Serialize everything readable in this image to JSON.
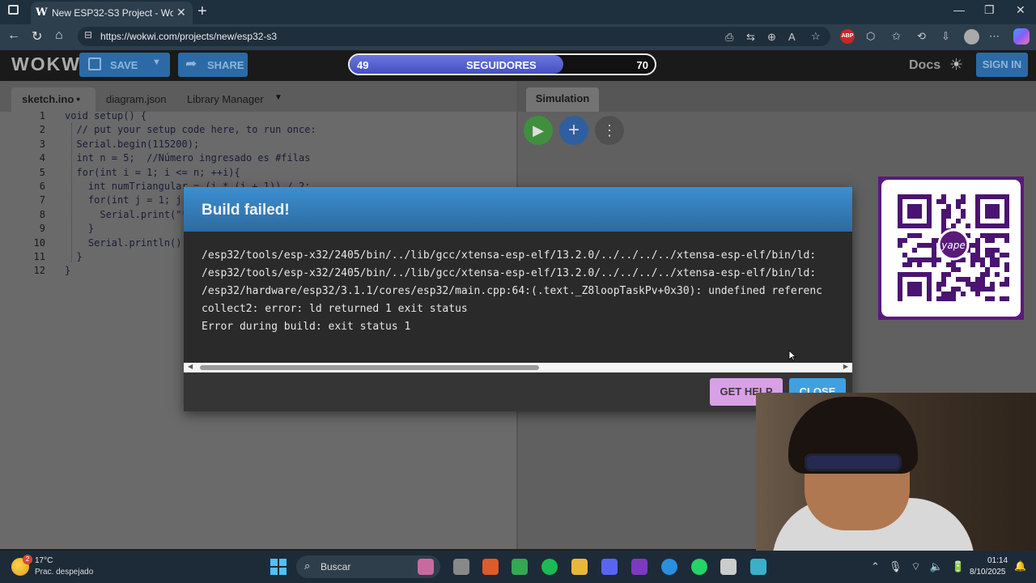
{
  "browser": {
    "tab_title": "New ESP32-S3 Project - Wokwi Si",
    "tab_favicon": "W",
    "url": "https://wokwi.com/projects/new/esp32-s3",
    "new_tab": "+",
    "close_tab": "✕",
    "window_controls": [
      "—",
      "❐",
      "✕"
    ],
    "nav": {
      "back": "←",
      "reload": "↻",
      "home": "⌂"
    },
    "extension_icons": [
      "⎙",
      "⇆",
      "⊕",
      "A",
      "☆"
    ],
    "abp_label": "ABP",
    "toolbar_icons": [
      "⬡",
      "✩",
      "⟲",
      "⇩",
      "⋯"
    ]
  },
  "wokwi": {
    "logo": "WOKWI",
    "save_label": "SAVE",
    "share_label": "SHARE",
    "docs_label": "Docs",
    "signin_label": "SIGN IN",
    "theme_icon": "☀"
  },
  "follower_bar": {
    "current": "49",
    "label": "SEGUIDORES",
    "goal": "70",
    "progress": 0.7
  },
  "editor": {
    "tabs": [
      {
        "label": "sketch.ino",
        "modified": true
      },
      {
        "label": "diagram.json"
      },
      {
        "label": "Library Manager"
      }
    ],
    "modified_dot": "●",
    "dropdown": "▼",
    "line_numbers": [
      "1",
      "2",
      "3",
      "4",
      "5",
      "6",
      "7",
      "8",
      "9",
      "10",
      "11",
      "12"
    ],
    "code_lines": [
      "void setup() {",
      "  // put your setup code here, to run once:",
      "  Serial.begin(115200);",
      "  int n = 5;  //Número ingresado es #filas",
      "  for(int i = 1; i <= n; ++i){",
      "    int numTriangular = (i * (i + 1)) / 2;",
      "    for(int j = 1; j",
      "      Serial.print(\"*",
      "    }",
      "    Serial.println();",
      "  }",
      "}"
    ]
  },
  "simulation": {
    "tab_label": "Simulation",
    "play_icon": "▶",
    "add_icon": "+",
    "more_icon": "⋮"
  },
  "modal": {
    "title": "Build failed!",
    "lines": [
      "/esp32/tools/esp-x32/2405/bin/../lib/gcc/xtensa-esp-elf/13.2.0/../../../../xtensa-esp-elf/bin/ld:",
      "/esp32/tools/esp-x32/2405/bin/../lib/gcc/xtensa-esp-elf/13.2.0/../../../../xtensa-esp-elf/bin/ld:",
      "/esp32/hardware/esp32/3.1.1/cores/esp32/main.cpp:64:(.text._Z8loopTaskPv+0x30): undefined referenc",
      "collect2: error: ld returned 1 exit status",
      "Error during build: exit status 1"
    ],
    "scroll_left": "◀",
    "scroll_right": "▶",
    "get_help_label": "GET HELP",
    "close_label": "CLOSE"
  },
  "qr_overlay": {
    "brand": "yape"
  },
  "taskbar": {
    "weather_badge": "2",
    "temperature": "17°C",
    "condition": "Prac. despejado",
    "search_icon": "⌕",
    "search_label": "Buscar",
    "system_icons": "⌃🎙⌔🔈🔋",
    "time": "01:14",
    "date": "8/10/2025",
    "bell": "🔔",
    "app_colors": [
      "#c86aa0",
      "#888888",
      "#e05a2a",
      "#34a853",
      "#1db954",
      "#e8b83a",
      "#5865f2",
      "#7b3ac0",
      "#2a8fe0",
      "#25d366",
      "#cccccc",
      "#3ab0c8"
    ]
  }
}
